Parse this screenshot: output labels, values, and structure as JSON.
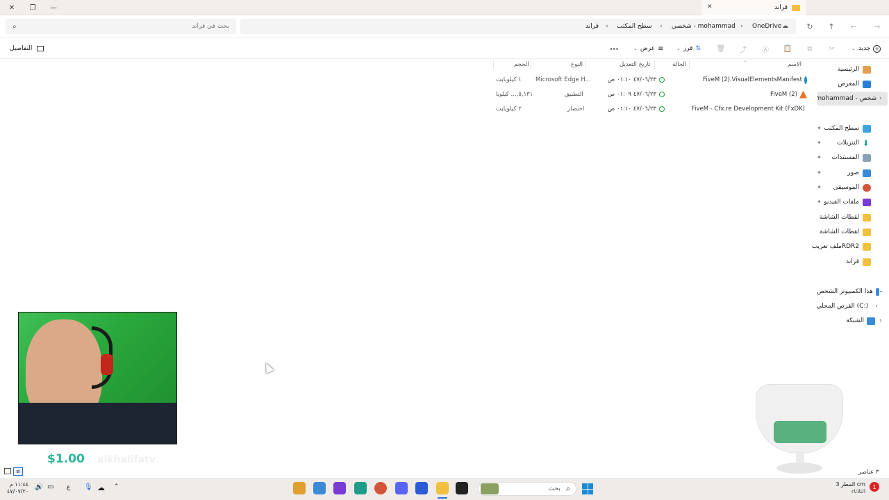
{
  "window": {
    "title": "قراند",
    "new_tab": "+",
    "close_tab": "✕"
  },
  "nav": {
    "search_placeholder": "بحث في قراند",
    "breadcrumbs": [
      "OneDrive",
      "شخصي - mohammad",
      "سطح المكتب",
      "قراند"
    ]
  },
  "toolbar": {
    "new_label": "جديد",
    "sort_label": "فرز",
    "view_label": "عرض",
    "more_label": "···",
    "details_label": "التفاصيل"
  },
  "sidebar": {
    "top": [
      {
        "label": "الرئيسية",
        "icon": "home-icon",
        "color": "#c97a2a"
      },
      {
        "label": "المعرض",
        "icon": "gallery-icon",
        "color": "#2a7fd4"
      },
      {
        "label": "mohammad - شخص",
        "icon": "onedrive-icon",
        "color": "#2a7fd4"
      }
    ],
    "pinned": [
      {
        "label": "سطح المكتب",
        "icon": "desktop-icon",
        "color": "#3fa3e0"
      },
      {
        "label": "التنزيلات",
        "icon": "download-icon",
        "color": "#1e9e8a"
      },
      {
        "label": "المستندات",
        "icon": "documents-icon",
        "color": "#8aa0b8"
      },
      {
        "label": "صور",
        "icon": "pictures-icon",
        "color": "#3a8ad6"
      },
      {
        "label": "الموسيقى",
        "icon": "music-icon",
        "color": "#d4543a"
      },
      {
        "label": "ملفات الفيديو",
        "icon": "video-icon",
        "color": "#7a3ad6"
      },
      {
        "label": "لقطات الشاشة",
        "icon": "folder-icon",
        "color": "#f2c040"
      },
      {
        "label": "لقطات الشاشة",
        "icon": "folder-icon",
        "color": "#f2c040"
      },
      {
        "label": "ملف تعريبRDR2",
        "icon": "folder-icon",
        "color": "#f2c040"
      },
      {
        "label": "قراند",
        "icon": "folder-icon",
        "color": "#f2c040"
      }
    ],
    "this_pc": "هذا الكمبيوتر الشخص",
    "local_disk": "القرص المحلي (C:)",
    "network": "الشبكة"
  },
  "table": {
    "headers": {
      "name": "الاسم",
      "status": "الحالة",
      "modified": "تاريخ التعديل",
      "type": "النوع",
      "size": "الحجم"
    },
    "rows": [
      {
        "name": "FiveM (2).VisualElementsManifest",
        "modified": "٤٧/٠٦/٢٣ ٠١:١٠ ص",
        "type": "Microsoft Edge H...",
        "size": "١ كيلوبايت",
        "icon": "edge-icon",
        "color": "#1b8ad6"
      },
      {
        "name": "FiveM (2)",
        "modified": "٤٧/٠٦/٢٣ ٠١:٠٩ ص",
        "type": "التطبيق",
        "size": "٥,١٣١,... كيلوبا",
        "icon": "fivem-icon",
        "color": "#e8742a"
      },
      {
        "name": "FiveM - Cfx.re Development Kit (FxDK)",
        "modified": "٤٧/٠٦/٢٣ ٠١:١٠ ص",
        "type": "اختصار",
        "size": "٢ كيلوبايت",
        "icon": "fxdk-icon",
        "color": "#e8742a"
      }
    ]
  },
  "status": {
    "item_count": "٣ عناصر"
  },
  "overlay": {
    "donation": "$1.00",
    "channel": "alkhalifatv"
  },
  "taskbar": {
    "weather_temp": "3 cm",
    "weather_label": "المطر",
    "weather_sub": "الثلاثاء",
    "search_placeholder": "بحث",
    "lang": "ع",
    "time": "١١:٤٤ م",
    "date": "٤٧/٠٧/٢٠",
    "notification_count": "1"
  }
}
